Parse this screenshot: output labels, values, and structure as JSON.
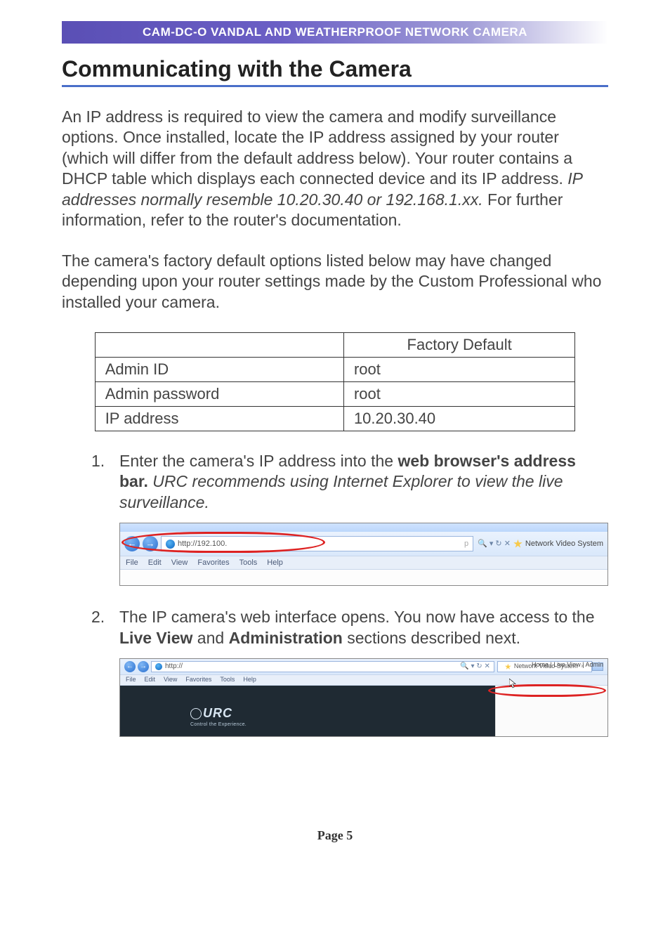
{
  "banner": "CAM-DC-O VANDAL AND WEATHERPROOF NETWORK CAMERA",
  "heading": "Communicating with the Camera",
  "para1_a": "An IP address is required to view the camera and modify surveillance options. Once installed, locate the IP address assigned by your router (which will differ from the default address below). Your router contains a DHCP table which displays each connected device and its IP address. ",
  "para1_em": "IP addresses normally resemble 10.20.30.40 or 192.168.1.xx.",
  "para1_b": " For further information, refer to the router's documentation.",
  "para2": "The camera's factory default options listed below may have changed depending upon your router settings made by the Custom Professional who installed your camera.",
  "table": {
    "header_blank": "",
    "header_default": "Factory Default",
    "rows": [
      {
        "label": "Admin ID",
        "value": "root"
      },
      {
        "label": "Admin password",
        "value": "root"
      },
      {
        "label": "IP address",
        "value": "10.20.30.40"
      }
    ]
  },
  "step1_a": "Enter the camera's IP address into the ",
  "step1_strong": "web browser's address bar.",
  "step1_em": " URC recommends using Internet Explorer to view the live surveillance.",
  "step2_a": "The IP camera's web interface opens. You now have access to the ",
  "step2_strong1": "Live View",
  "step2_mid": " and ",
  "step2_strong2": "Administration",
  "step2_b": " sections described next.",
  "ie": {
    "url_text": "http://192.100.",
    "url_hint": "p",
    "search_sym": "🔍 ▾ ↻ ✕",
    "tab_title": "Network Video System",
    "menu": [
      "File",
      "Edit",
      "View",
      "Favorites",
      "Tools",
      "Help"
    ]
  },
  "ie2": {
    "url_text": "http://",
    "tab_title": "Network Video System",
    "links": "Home  |  Live View  |  Admin",
    "logo_text": "URC",
    "logo_tag": "Control the Experience."
  },
  "footer": "Page 5"
}
